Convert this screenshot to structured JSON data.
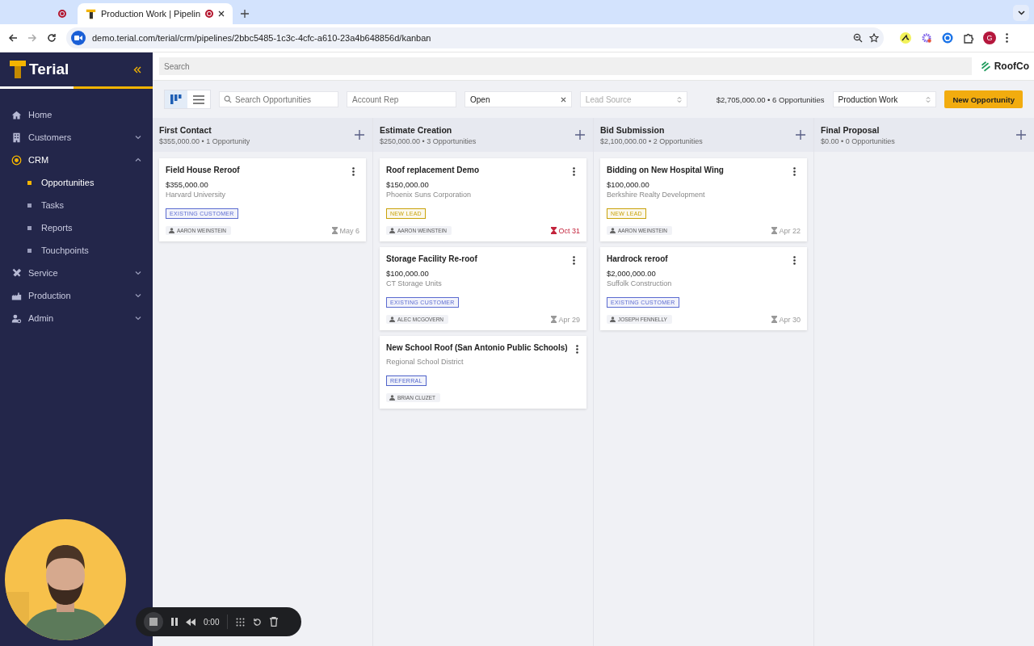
{
  "browser": {
    "tabs": [
      {
        "selected": false
      },
      {
        "title": "Production Work | Pipelin",
        "selected": true
      }
    ],
    "url": "demo.terial.com/terial/crm/pipelines/2bbc5485-1c3c-4cfc-a610-23a4b648856d/kanban",
    "profile": "G"
  },
  "sidebar": {
    "logo": "Terial",
    "items": [
      {
        "label": "Home",
        "selected": false
      },
      {
        "label": "Customers",
        "expanded": false,
        "selected": false
      },
      {
        "label": "CRM",
        "expanded": true,
        "selected": true,
        "children": [
          {
            "label": "Opportunities",
            "selected": true
          },
          {
            "label": "Tasks",
            "selected": false
          },
          {
            "label": "Reports",
            "selected": false
          },
          {
            "label": "Touchpoints",
            "selected": false
          }
        ]
      },
      {
        "label": "Service",
        "expanded": false,
        "selected": false
      },
      {
        "label": "Production",
        "expanded": false,
        "selected": false
      },
      {
        "label": "Admin",
        "expanded": false,
        "selected": false
      }
    ]
  },
  "topbar": {
    "search_placeholder": "Search",
    "org": "RoofCo"
  },
  "toolbar": {
    "views": [
      {
        "kind": "board",
        "selected": true
      },
      {
        "kind": "list",
        "selected": false
      }
    ],
    "search_placeholder": "Search Opportunities",
    "account_rep_placeholder": "Account Rep",
    "status": "Open",
    "lead_source_placeholder": "Lead Source",
    "summary": "$2,705,000.00 • 6 Opportunities",
    "pipeline": "Production Work",
    "new_button": "New Opportunity"
  },
  "columns": [
    {
      "title": "First Contact",
      "summary": "$355,000.00 • 1 Opportunity",
      "cards": [
        {
          "title": "Field House Reroof",
          "amount": "$355,000.00",
          "company": "Harvard University",
          "tag": {
            "label": "EXISTING CUSTOMER",
            "color": "#5b6bd0"
          },
          "owner": "AARON WEINSTEIN",
          "due": "May 6",
          "overdue": false
        }
      ]
    },
    {
      "title": "Estimate Creation",
      "summary": "$250,000.00 • 3 Opportunities",
      "cards": [
        {
          "title": "Roof replacement Demo",
          "amount": "$150,000.00",
          "company": "Phoenix Suns Corporation",
          "tag": {
            "label": "NEW LEAD",
            "color": "#c9a20a"
          },
          "owner": "AARON WEINSTEIN",
          "due": "Oct 31",
          "overdue": true
        },
        {
          "title": "Storage Facility Re-roof",
          "amount": "$100,000.00",
          "company": "CT Storage Units",
          "tag": {
            "label": "EXISTING CUSTOMER",
            "color": "#5b6bd0"
          },
          "owner": "ALEC MCGOVERN",
          "due": "Apr 29",
          "overdue": false
        },
        {
          "title": "New School Roof (San Antonio Public Schools)",
          "company": "Regional School District",
          "tag": {
            "label": "REFERRAL",
            "color": "#4f63c9"
          },
          "owner": "BRIAN CLUZET"
        }
      ]
    },
    {
      "title": "Bid Submission",
      "summary": "$2,100,000.00 • 2 Opportunities",
      "cards": [
        {
          "title": "Bidding on New Hospital Wing",
          "amount": "$100,000.00",
          "company": "Berkshire Realty Development",
          "tag": {
            "label": "NEW LEAD",
            "color": "#c9a20a"
          },
          "owner": "AARON WEINSTEIN",
          "due": "Apr 22",
          "overdue": false
        },
        {
          "title": "Hardrock reroof",
          "amount": "$2,000,000.00",
          "company": "Suffolk Construction",
          "tag": {
            "label": "EXISTING CUSTOMER",
            "color": "#5b6bd0"
          },
          "owner": "JOSEPH FENNELLY",
          "due": "Apr 30",
          "overdue": false
        }
      ]
    },
    {
      "title": "Final Proposal",
      "summary": "$0.00 • 0 Opportunities"
    }
  ],
  "recorder": {
    "time": "0:00"
  }
}
